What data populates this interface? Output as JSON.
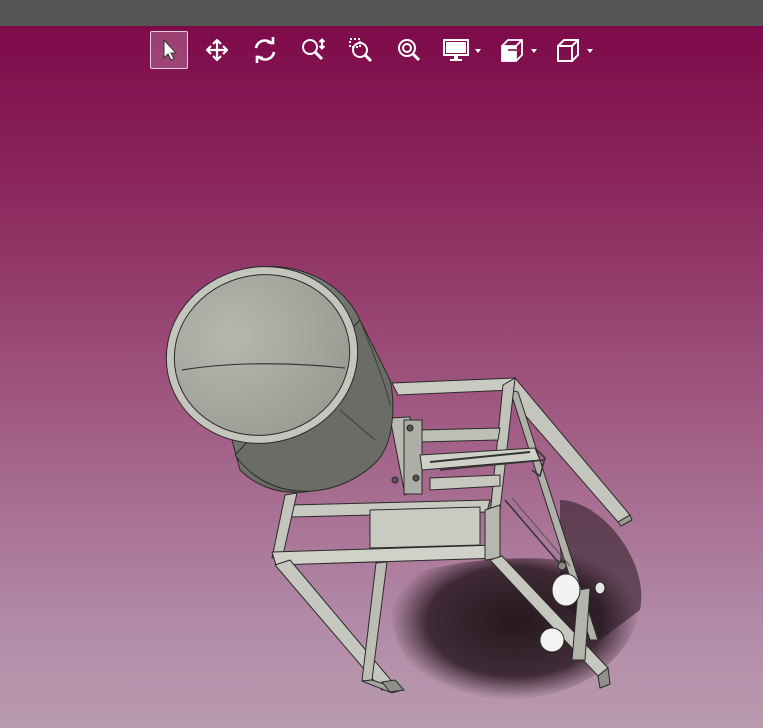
{
  "window": {
    "title_bar_color": "#555555"
  },
  "viewport": {
    "background_top": "#7e0a4a",
    "background_bottom": "#b99aae"
  },
  "toolbar": {
    "tools": [
      {
        "id": "select",
        "icon": "arrow-pointer-icon",
        "active": true
      },
      {
        "id": "pan",
        "icon": "move-arrows-icon",
        "active": false
      },
      {
        "id": "rotate",
        "icon": "rotate-icon",
        "active": false
      },
      {
        "id": "zoom",
        "icon": "zoom-updown-icon",
        "active": false
      },
      {
        "id": "zoom-window",
        "icon": "zoom-box-icon",
        "active": false
      },
      {
        "id": "zoom-fit",
        "icon": "zoom-fit-icon",
        "active": false
      },
      {
        "id": "display-mode",
        "icon": "monitor-icon",
        "dropdown": true
      },
      {
        "id": "section-view",
        "icon": "section-cube-icon",
        "dropdown": true
      },
      {
        "id": "view-orientation",
        "icon": "cube-icon",
        "dropdown": true
      }
    ]
  },
  "model": {
    "name_visible": false,
    "drum_color": "#a9aba2",
    "frame_color": "#c4c5bc",
    "edge_color": "#2a2a2a"
  }
}
